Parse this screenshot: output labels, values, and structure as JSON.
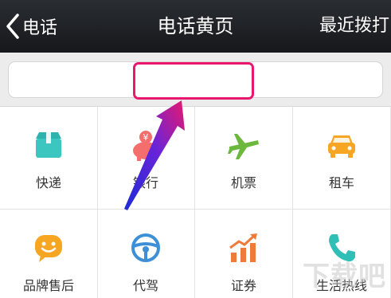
{
  "navbar": {
    "back_label": "电话",
    "title": "电话黄页",
    "recent_label": "最近拨打"
  },
  "search": {
    "placeholder": ""
  },
  "categories": [
    {
      "label": "快递",
      "icon": "package-icon",
      "color": "#3cc6c0"
    },
    {
      "label": "银行",
      "icon": "piggy-bank-icon",
      "color": "#f46e6e"
    },
    {
      "label": "机票",
      "icon": "airplane-icon",
      "color": "#6cb83e"
    },
    {
      "label": "租车",
      "icon": "car-icon",
      "color": "#f6a623"
    },
    {
      "label": "品牌售后",
      "icon": "smiley-chat-icon",
      "color": "#f6a623"
    },
    {
      "label": "代驾",
      "icon": "steering-wheel-icon",
      "color": "#3d8fd8"
    },
    {
      "label": "证券",
      "icon": "stock-chart-icon",
      "color": "#f07a3a"
    },
    {
      "label": "生活热线",
      "icon": "phone-icon",
      "color": "#2fbfb7"
    }
  ],
  "annotation": {
    "highlight_color": "#e8186e"
  },
  "watermark": "下载吧"
}
